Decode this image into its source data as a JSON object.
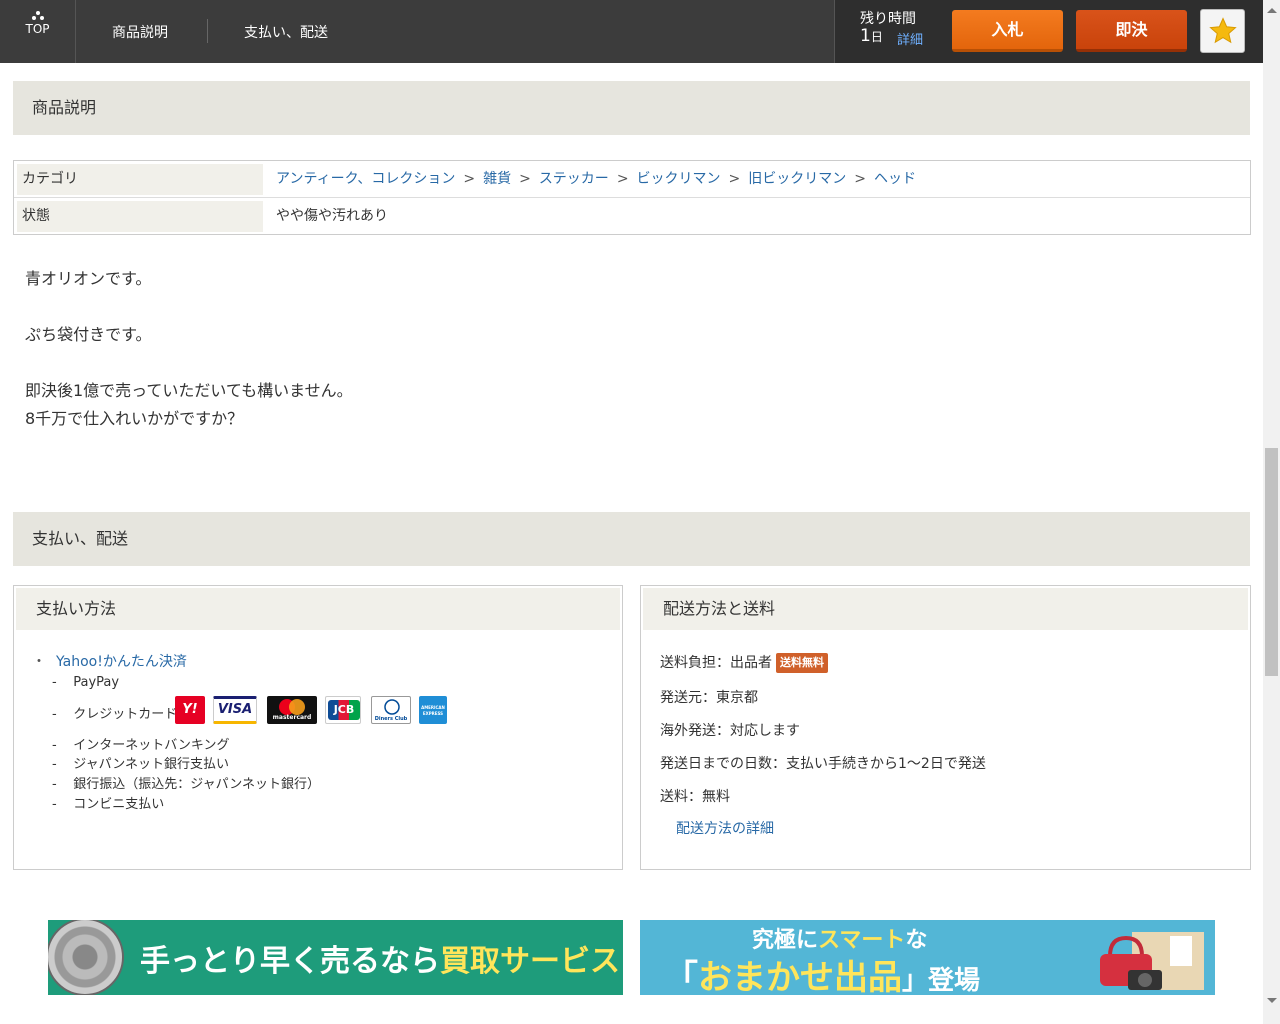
{
  "nav": {
    "top_label": "TOP",
    "item1": "商品説明",
    "item2": "支払い、配送"
  },
  "timer": {
    "label": "残り時間",
    "value": "1",
    "unit": "日",
    "detail": "詳細"
  },
  "actions": {
    "bid": "入札",
    "buy_now": "即決",
    "watch_icon": "star-icon"
  },
  "description_section": {
    "title": "商品説明",
    "category_label": "カテゴリ",
    "category_path": [
      "アンティーク、コレクション",
      "雑貨",
      "ステッカー",
      "ビックリマン",
      "旧ビックリマン",
      "ヘッド"
    ],
    "crumb_separator": ">",
    "condition_label": "状態",
    "condition_value": "やや傷や汚れあり",
    "text_lines": [
      "青オリオンです。",
      "",
      "ぷち袋付きです。",
      "",
      "即決後1億で売っていただいても構いません。",
      "8千万で仕入れいかがですか？"
    ]
  },
  "payment_shipping_section": {
    "title": "支払い、配送",
    "payment": {
      "title": "支払い方法",
      "main": "Yahoo!かんたん決済",
      "paypay": "PayPay",
      "credit": "クレジットカード",
      "cards": [
        "Y!",
        "VISA",
        "mastercard",
        "JCB",
        "Diners Club",
        "AMERICAN EXPRESS"
      ],
      "netbank": "インターネットバンキング",
      "japannet": "ジャパンネット銀行支払い",
      "transfer": "銀行振込（振込先：ジャパンネット銀行）",
      "convenience": "コンビニ支払い",
      "dash": "-"
    },
    "shipping": {
      "title": "配送方法と送料",
      "burden": "送料負担：出品者",
      "free_badge": "送料無料",
      "origin": "発送元：東京都",
      "overseas": "海外発送：対応します",
      "days": "発送日までの日数：支払い手続きから1～2日で発送",
      "fee": "送料：無料",
      "detail_link": "配送方法の詳細"
    }
  },
  "banners": {
    "left": {
      "text_a": "手っとり早く売るなら",
      "text_b": "買取サービス"
    },
    "right": {
      "top_a": "究極に",
      "top_b": "スマート",
      "top_c": "な",
      "main_a": "「",
      "main_b": "おまかせ出品",
      "main_c": "」登場"
    }
  },
  "colors": {
    "bid": "#e86a10",
    "buy": "#cf4810",
    "header_bg": "#3c3c3c",
    "section_bg": "#e6e5de",
    "link": "#2869a6"
  }
}
